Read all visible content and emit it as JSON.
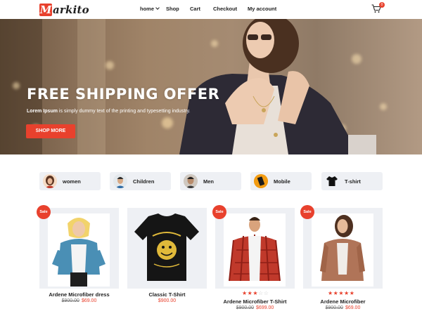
{
  "header": {
    "logo_initial": "M",
    "logo_rest": "arkito",
    "nav": {
      "home": "home",
      "shop": "Shop",
      "cart": "Cart",
      "checkout": "Checkout",
      "account": "My account"
    },
    "cart_count": "0"
  },
  "hero": {
    "title": "FREE SHIPPING OFFER",
    "subtitle_bold": "Lorem Ipsum",
    "subtitle_rest": " is simply dummy text of the printing and typesetting industry.",
    "button": "SHOP MORE"
  },
  "categories": [
    {
      "label": "women",
      "icon": "woman-avatar-icon"
    },
    {
      "label": "Children",
      "icon": "child-avatar-icon"
    },
    {
      "label": "Men",
      "icon": "man-avatar-icon"
    },
    {
      "label": "Mobile",
      "icon": "mobile-phone-icon"
    },
    {
      "label": "T-shirt",
      "icon": "tshirt-icon"
    }
  ],
  "products": [
    {
      "name": "Ardene Microfiber dress",
      "old_price": "$900.00",
      "new_price": "$69.00",
      "sale": "Sale",
      "rating": 0
    },
    {
      "name": "Classic T-Shirt",
      "price": "$900.00",
      "rating": 0
    },
    {
      "name": "Ardene Microfiber T-Shirt",
      "old_price": "$900.00",
      "new_price": "$699.00",
      "sale": "Sale",
      "rating": 2.5
    },
    {
      "name": "Ardene Microfiber",
      "old_price": "$900.00",
      "new_price": "$69.00",
      "sale": "Sale",
      "rating": 5
    }
  ],
  "colors": {
    "accent": "#e8412d",
    "card_bg": "#eef0f4",
    "star": "#e8412d"
  }
}
